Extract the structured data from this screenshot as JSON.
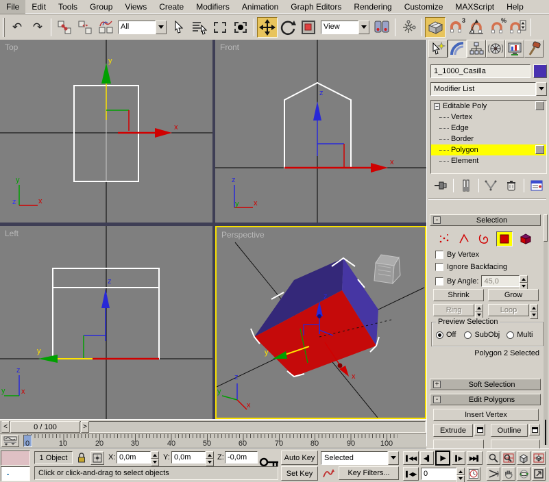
{
  "window": {
    "colors": {
      "accent_active": "#e8c45c",
      "selection_yellow": "#ffff00",
      "viewport_bg": "#7f7f7f",
      "active_viewport_border": "#f8e000",
      "object_color": "#4831b0",
      "face_red": "#c50a0a",
      "face_purple_dark": "#342879",
      "face_purple_light": "#4636a3"
    }
  },
  "menu": {
    "items": [
      "File",
      "Edit",
      "Tools",
      "Group",
      "Views",
      "Create",
      "Modifiers",
      "Animation",
      "Graph Editors",
      "Rendering",
      "Customize",
      "MAXScript",
      "Help"
    ]
  },
  "toolbar": {
    "undo_glyph": "↶",
    "redo_glyph": "↷",
    "selection_filter": "All",
    "coordinate_system": "View",
    "angle_snap_sup": "3",
    "percent_snap_sup": "%"
  },
  "viewports": {
    "top_label": "Top",
    "front_label": "Front",
    "left_label": "Left",
    "perspective_label": "Perspective"
  },
  "command_panel": {
    "object_name": "1_1000_Casilla",
    "modifier_list": "Modifier List",
    "stack": {
      "root": "Editable Poly",
      "expand_glyph": "−",
      "children": [
        "Vertex",
        "Edge",
        "Border",
        "Polygon",
        "Element"
      ],
      "selected": "Polygon"
    },
    "selection_rollout": {
      "title": "Selection",
      "collapse_glyph": "-",
      "by_vertex": "By Vertex",
      "ignore_backfacing": "Ignore Backfacing",
      "by_angle": "By Angle:",
      "angle_value": "45,0",
      "shrink": "Shrink",
      "grow": "Grow",
      "ring": "Ring",
      "loop": "Loop"
    },
    "preview_selection": {
      "title": "Preview Selection",
      "off": "Off",
      "subobj": "SubObj",
      "multi": "Multi",
      "selected": "Off"
    },
    "selection_status": "Polygon 2 Selected",
    "soft_selection_title": "Soft Selection",
    "soft_selection_glyph": "+",
    "edit_polygons_title": "Edit Polygons",
    "edit_polygons_glyph": "-",
    "insert_vertex": "Insert Vertex",
    "extrude": "Extrude",
    "outline": "Outline"
  },
  "timeline": {
    "slider_value": "0 / 100",
    "prev_glyph": "<",
    "next_glyph": ">",
    "ticks": [
      "0",
      "10",
      "20",
      "30",
      "40",
      "50",
      "60",
      "70",
      "80",
      "90",
      "100"
    ]
  },
  "status_bar": {
    "object_count": "1 Object",
    "x_label": "X:",
    "x_value": "0,0m",
    "y_label": "Y:",
    "y_value": "0,0m",
    "z_label": "Z:",
    "z_value": "-0,0m",
    "prompt": "Click or click-and-drag to select objects",
    "auto_key": "Auto Key",
    "set_key": "Set Key",
    "key_filter_mode": "Selected",
    "key_filters": "Key Filters...",
    "frame_field": "0",
    "playback": {
      "go_start": "▌◀◀",
      "prev_frame": "◀▌",
      "play": "▶",
      "next_frame": "▌▶",
      "go_end": "▶▶▌",
      "key_mode": "▌◀▶"
    }
  }
}
